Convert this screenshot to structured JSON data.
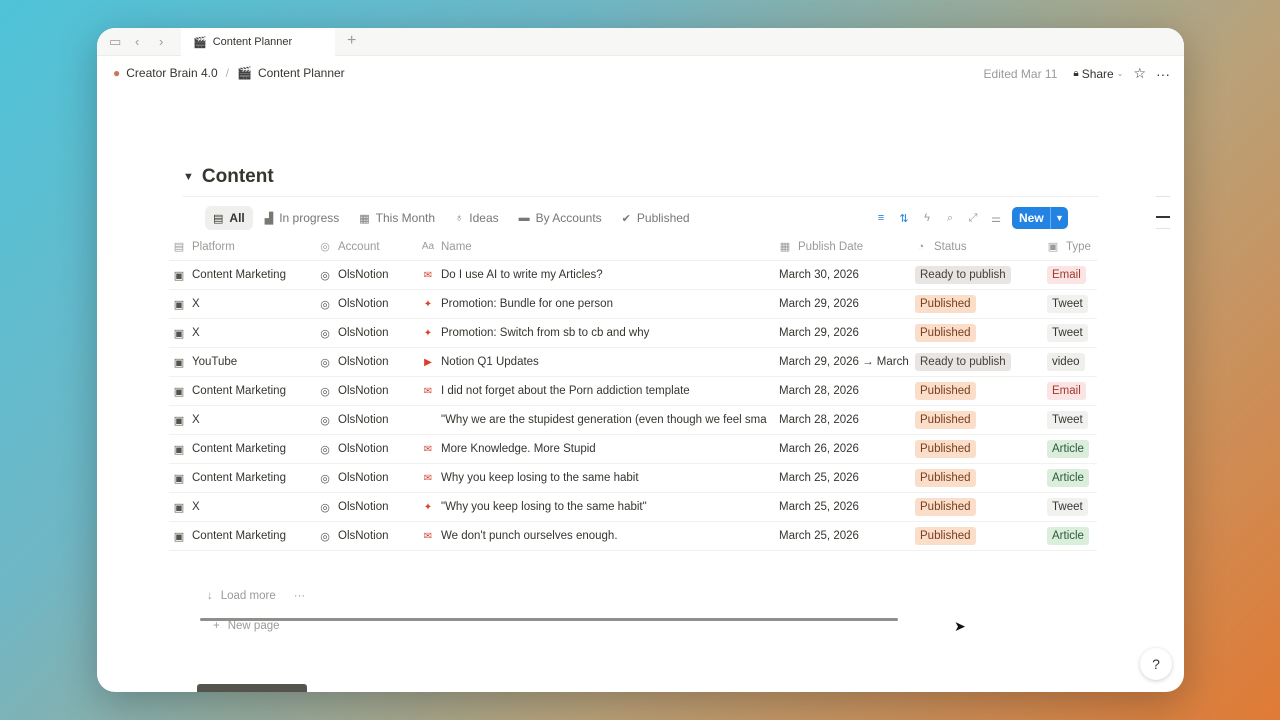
{
  "tab": {
    "title": "Content Planner"
  },
  "breadcrumb": {
    "workspace": "Creator Brain 4.0",
    "page": "Content Planner"
  },
  "topbar": {
    "edited": "Edited Mar 11",
    "share": "Share"
  },
  "section": {
    "title": "Content"
  },
  "views": [
    {
      "label": "All",
      "icon": "stack-icon"
    },
    {
      "label": "In progress",
      "icon": "chart-icon"
    },
    {
      "label": "This Month",
      "icon": "calendar-icon"
    },
    {
      "label": "Ideas",
      "icon": "lightbulb-icon"
    },
    {
      "label": "By Accounts",
      "icon": "folder-icon"
    },
    {
      "label": "Published",
      "icon": "check-circle-icon"
    }
  ],
  "new_button": {
    "label": "New"
  },
  "columns": {
    "platform": "Platform",
    "account": "Account",
    "name": "Name",
    "publish_date": "Publish Date",
    "status": "Status",
    "type": "Type"
  },
  "rows": [
    {
      "platform": "Content Marketing",
      "account": "OlsNotion",
      "name_icon": "gmail-icon",
      "name": "Do I use AI to write my Articles?",
      "date": "March 30, 2026",
      "status": "Ready to publish",
      "type": "Email"
    },
    {
      "platform": "X",
      "account": "OlsNotion",
      "name_icon": "twitter-icon",
      "name": "Promotion: Bundle for one person",
      "date": "March 29, 2026",
      "status": "Published",
      "type": "Tweet"
    },
    {
      "platform": "X",
      "account": "OlsNotion",
      "name_icon": "twitter-icon",
      "name": "Promotion: Switch from sb to cb and why",
      "date": "March 29, 2026",
      "status": "Published",
      "type": "Tweet"
    },
    {
      "platform": "YouTube",
      "account": "OlsNotion",
      "name_icon": "youtube-icon",
      "name": "Notion Q1 Updates",
      "date": "March 29, 2026 → March",
      "status": "Ready to publish",
      "type": "video"
    },
    {
      "platform": "Content Marketing",
      "account": "OlsNotion",
      "name_icon": "gmail-icon",
      "name": "I did not forget about the Porn addiction template",
      "date": "March 28, 2026",
      "status": "Published",
      "type": "Email"
    },
    {
      "platform": "X",
      "account": "OlsNotion",
      "name_icon": "",
      "name": "\"Why we are the stupidest generation (even though we feel sma",
      "date": "March 28, 2026",
      "status": "Published",
      "type": "Tweet"
    },
    {
      "platform": "Content Marketing",
      "account": "OlsNotion",
      "name_icon": "gmail-icon",
      "name": "More Knowledge. More Stupid",
      "date": "March 26, 2026",
      "status": "Published",
      "type": "Article"
    },
    {
      "platform": "Content Marketing",
      "account": "OlsNotion",
      "name_icon": "gmail-icon",
      "name": "Why you keep losing to the same habit",
      "date": "March 25, 2026",
      "status": "Published",
      "type": "Article"
    },
    {
      "platform": "X",
      "account": "OlsNotion",
      "name_icon": "twitter-icon",
      "name": "\"Why you keep losing to the same habit\"",
      "date": "March 25, 2026",
      "status": "Published",
      "type": "Tweet"
    },
    {
      "platform": "Content Marketing",
      "account": "OlsNotion",
      "name_icon": "gmail-icon",
      "name": "We don't punch ourselves enough.",
      "date": "March 25, 2026",
      "status": "Published",
      "type": "Article"
    }
  ],
  "footer": {
    "load_more": "Load more",
    "new_page": "New page"
  },
  "colors": {
    "accent": "#2383e2",
    "published_bg": "#fadec9",
    "ready_bg": "#e9e5e3",
    "article_bg": "#dbeddb",
    "email_bg": "#fbe4e4"
  }
}
